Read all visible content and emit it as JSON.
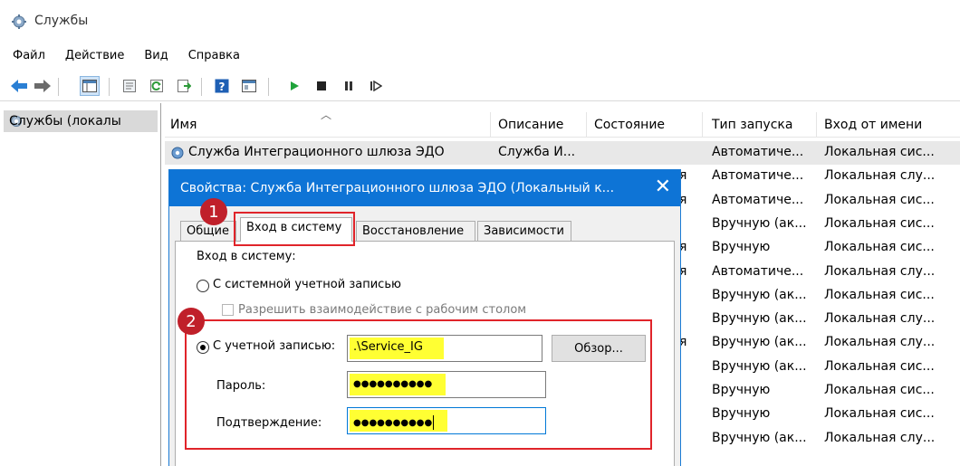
{
  "window": {
    "title": "Службы",
    "icon": "services-gear-icon"
  },
  "menu": [
    "Файл",
    "Действие",
    "Вид",
    "Справка"
  ],
  "toolbar": {
    "buttons": [
      "back-arrow-icon",
      "forward-arrow-icon",
      "show-tree-icon",
      "properties-icon",
      "refresh-icon",
      "export-list-icon",
      "help-icon",
      "console-view-icon",
      "start-service-icon",
      "stop-service-icon",
      "pause-service-icon",
      "resume-service-icon"
    ]
  },
  "tree": {
    "item": "Службы (локалы"
  },
  "columns": {
    "name": "Имя",
    "description": "Описание",
    "status": "Состояние",
    "startup": "Тип запуска",
    "logon": "Вход от имени"
  },
  "rows": [
    {
      "name": "Служба Интеграционного шлюза ЭДО",
      "description": "Служба И...",
      "partial": "",
      "startup": "Автоматиче...",
      "logon": "Локальная сис..."
    },
    {
      "name": "",
      "description": "",
      "partial": "я",
      "startup": "Автоматиче...",
      "logon": "Локальная слу..."
    },
    {
      "name": "",
      "description": "",
      "partial": "я",
      "startup": "Автоматиче...",
      "logon": "Локальная сис..."
    },
    {
      "name": "",
      "description": "",
      "partial": "",
      "startup": "Вручную (ак...",
      "logon": "Локальная сис..."
    },
    {
      "name": "",
      "description": "",
      "partial": "я",
      "startup": "Вручную",
      "logon": "Локальная сис..."
    },
    {
      "name": "",
      "description": "",
      "partial": "я",
      "startup": "Автоматиче...",
      "logon": "Локальная слу..."
    },
    {
      "name": "",
      "description": "",
      "partial": "",
      "startup": "Вручную (ак...",
      "logon": "Локальная сис..."
    },
    {
      "name": "",
      "description": "",
      "partial": "",
      "startup": "Вручную (ак...",
      "logon": "Локальная слу..."
    },
    {
      "name": "",
      "description": "",
      "partial": "я",
      "startup": "Вручную (ак...",
      "logon": "Локальная слу..."
    },
    {
      "name": "",
      "description": "",
      "partial": "",
      "startup": "Вручную (ак...",
      "logon": "Локальная сис..."
    },
    {
      "name": "",
      "description": "",
      "partial": "",
      "startup": "Вручную",
      "logon": "Локальная сис..."
    },
    {
      "name": "",
      "description": "",
      "partial": "",
      "startup": "Вручную",
      "logon": "Локальная сис..."
    },
    {
      "name": "",
      "description": "",
      "partial": "",
      "startup": "Вручную (ак...",
      "logon": "Локальная слу..."
    }
  ],
  "dialog": {
    "title": "Свойства: Служба Интеграционного шлюза ЭДО (Локальный к...",
    "close": "✕",
    "tabs": [
      "Общие",
      "Вход в систему",
      "Восстановление",
      "Зависимости"
    ],
    "group_label": "Вход в систему:",
    "system_account_label": "С системной учетной записью",
    "desktop_interact_label": "Разрешить взаимодействие с рабочим столом",
    "this_account_label": "С учетной записью:",
    "account_value": ".\\Service_IG",
    "browse_label": "Обзор...",
    "password_label": "Пароль:",
    "password_value": "●●●●●●●●●●",
    "confirm_label": "Подтверждение:",
    "confirm_value": "●●●●●●●●●●"
  },
  "annotations": {
    "badge1": "1",
    "badge2": "2"
  },
  "colors": {
    "dialog_title": "#0e74d6",
    "annotation": "#e0242a",
    "badge": "#c0202a",
    "highlight": "#ffff33"
  }
}
